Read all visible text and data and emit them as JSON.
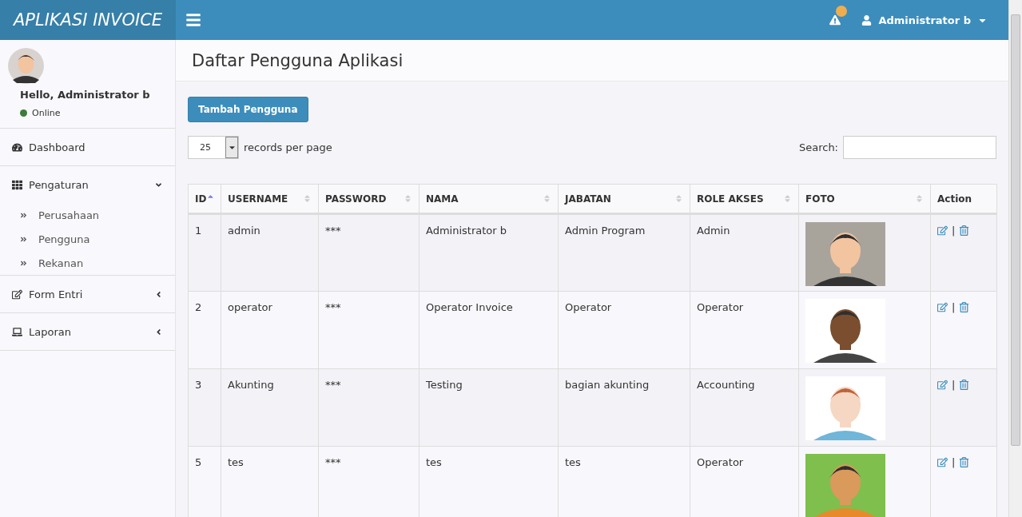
{
  "header": {
    "logo": "APLIKASI INVOICE",
    "user": "Administrator b",
    "alert_badge": true
  },
  "sidebar": {
    "user": {
      "greeting": "Hello, Administrator b",
      "status": "Online"
    },
    "items": [
      {
        "label": "Dashboard"
      },
      {
        "label": "Pengaturan",
        "expanded": true,
        "children": [
          {
            "label": "Perusahaan"
          },
          {
            "label": "Pengguna"
          },
          {
            "label": "Rekanan"
          }
        ]
      },
      {
        "label": "Form Entri",
        "expanded": false
      },
      {
        "label": "Laporan",
        "expanded": false
      }
    ]
  },
  "page": {
    "title": "Daftar Pengguna Aplikasi",
    "add_button": "Tambah Pengguna",
    "page_size": "25",
    "page_size_label": "records per page",
    "search_label": "Search:"
  },
  "table": {
    "columns": [
      {
        "label": "ID",
        "sorted": true
      },
      {
        "label": "USERNAME",
        "sorted": false
      },
      {
        "label": "PASSWORD",
        "sorted": false
      },
      {
        "label": "NAMA",
        "sorted": false
      },
      {
        "label": "JABATAN",
        "sorted": false
      },
      {
        "label": "ROLE AKSES",
        "sorted": false
      },
      {
        "label": "FOTO",
        "sorted": false
      },
      {
        "label": "Action"
      }
    ],
    "rows": [
      {
        "id": "1",
        "username": "admin",
        "password": "***",
        "nama": "Administrator b",
        "jabatan": "Admin Program",
        "role": "Admin",
        "separator": "|"
      },
      {
        "id": "2",
        "username": "operator",
        "password": "***",
        "nama": "Operator Invoice",
        "jabatan": "Operator",
        "role": "Operator",
        "separator": "|"
      },
      {
        "id": "3",
        "username": "Akunting",
        "password": "***",
        "nama": "Testing",
        "jabatan": "bagian akunting",
        "role": "Accounting",
        "separator": "|"
      },
      {
        "id": "5",
        "username": "tes",
        "password": "***",
        "nama": "tes",
        "jabatan": "tes",
        "role": "Operator",
        "separator": "|"
      }
    ]
  }
}
